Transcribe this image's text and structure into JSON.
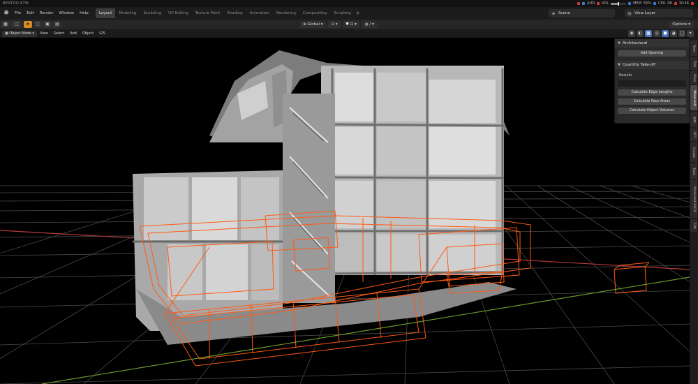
{
  "app": {
    "title": "BENTOO 87W"
  },
  "status": {
    "audio_label": "AUD",
    "vol_label": "VOL",
    "mem_label": "MEM",
    "mem_value": "55%",
    "cpu_label": "CPU",
    "cpu_value": "08",
    "clock": "10:46"
  },
  "menu": [
    "File",
    "Edit",
    "Render",
    "Window",
    "Help"
  ],
  "workspaces": [
    {
      "label": "Layout",
      "active": true
    },
    {
      "label": "Modeling"
    },
    {
      "label": "Sculpting"
    },
    {
      "label": "UV Editing"
    },
    {
      "label": "Texture Paint"
    },
    {
      "label": "Shading"
    },
    {
      "label": "Animation"
    },
    {
      "label": "Rendering"
    },
    {
      "label": "Compositing"
    },
    {
      "label": "Scripting"
    }
  ],
  "scene": {
    "label": "Scene"
  },
  "view_layer": {
    "label": "View Layer"
  },
  "toolbar": {
    "orientation": "Global",
    "options_label": "Options"
  },
  "viewport_header": {
    "mode": "Object Mode",
    "menus": [
      "View",
      "Select",
      "Add",
      "Object",
      "GIS"
    ]
  },
  "npanel": {
    "sections": [
      {
        "title": "Architectural",
        "buttons": [
          "Add Opening"
        ]
      },
      {
        "title": "Quantity Take-off",
        "results_label": "Results",
        "buttons": [
          "Calculate Edge Lengths",
          "Calculate Face Areas",
          "Calculate Object Volumes"
        ]
      }
    ]
  },
  "side_tabs": [
    "Item",
    "Tool",
    "View",
    "Measureit",
    "BIM",
    "BCF",
    "Create",
    "Tools",
    "Measureit-ARCH",
    "Edit"
  ],
  "colors": {
    "accent": "#d48a25",
    "selection_orange": "#ff5a14",
    "axis_red": "#b53a3a",
    "axis_green": "#6a9a2a",
    "active_blue": "#4772b3"
  },
  "icons": [
    "blender-logo",
    "select-box-icon",
    "cursor-icon",
    "transform-orientation-icon",
    "snap-icon",
    "proportional-edit-icon",
    "scene-icon",
    "view-layer-icon",
    "shading-wireframe-icon",
    "shading-solid-icon",
    "shading-material-icon",
    "shading-rendered-icon"
  ]
}
